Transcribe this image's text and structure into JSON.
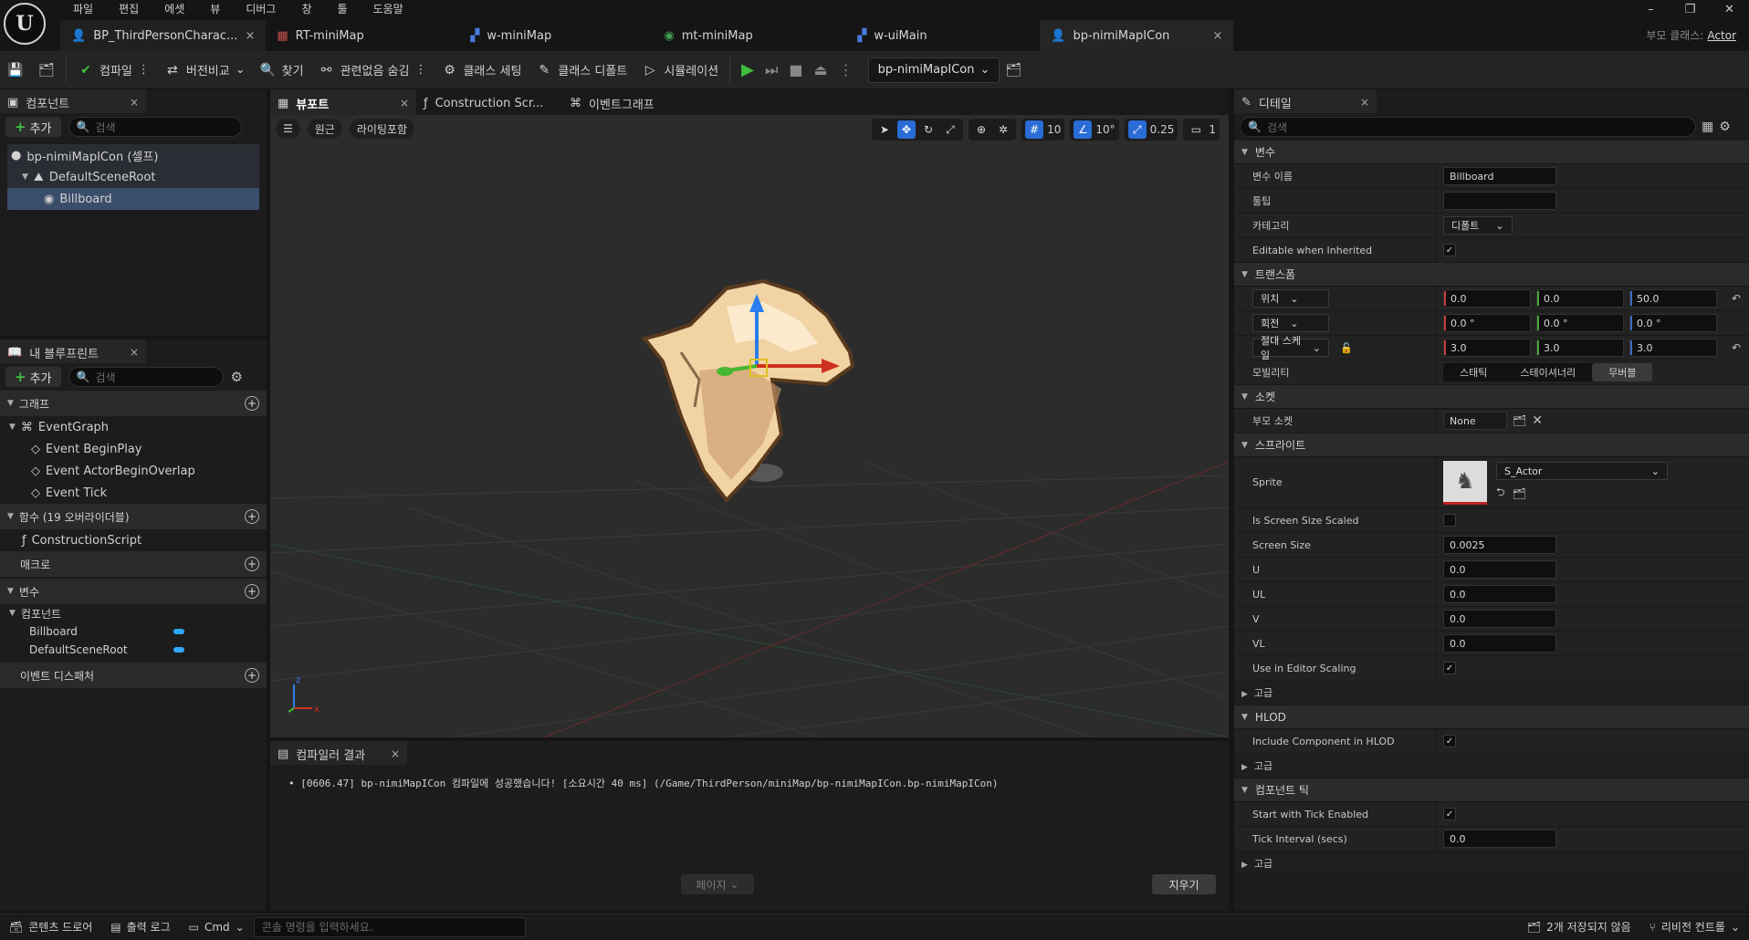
{
  "menu": [
    "파일",
    "편집",
    "에셋",
    "뷰",
    "디버그",
    "창",
    "툴",
    "도움말"
  ],
  "doc_tabs": [
    {
      "label": "BP_ThirdPersonCharac...",
      "close": "×"
    },
    {
      "label": "RT-miniMap"
    },
    {
      "label": "w-miniMap"
    },
    {
      "label": "mt-miniMap"
    },
    {
      "label": "w-uiMain"
    },
    {
      "label": "bp-nimiMapICon",
      "close": "×"
    }
  ],
  "window_buttons": [
    "–",
    "❐",
    "✕"
  ],
  "parent_class": {
    "label": "부모 클래스:",
    "value": "Actor"
  },
  "toolbar": {
    "compile": "컴파일",
    "diff": "버전비교",
    "find": "찾기",
    "hide_unrelated": "관련없음 숨김",
    "class_settings": "클래스 세팅",
    "class_defaults": "클래스 디폴트",
    "simulation": "시뮬레이션",
    "debug_object": "bp-nimiMapICon"
  },
  "components_panel": {
    "tab": "컴포넌트",
    "add": "추가",
    "search_placeholder": "검색",
    "items": [
      {
        "label": "bp-nimiMapICon (셀프)"
      },
      {
        "label": "DefaultSceneRoot"
      },
      {
        "label": "Billboard"
      }
    ]
  },
  "my_blueprint": {
    "tab": "내 블루프린트",
    "add": "추가",
    "search_placeholder": "검색",
    "graph_header": "그래프",
    "event_graph": "EventGraph",
    "events": [
      "Event BeginPlay",
      "Event ActorBeginOverlap",
      "Event Tick"
    ],
    "functions_header": "함수 (19 오버라이더블)",
    "construction_script": "ConstructionScript",
    "macros_header": "매크로",
    "variables_header": "변수",
    "components_header": "컴포넌트",
    "variables": [
      "Billboard",
      "DefaultSceneRoot"
    ],
    "dispatchers_header": "이벤트 디스패처"
  },
  "center_tabs": [
    "뷰포트",
    "Construction Scr...",
    "이벤트그래프"
  ],
  "viewport": {
    "perspective": "원근",
    "lit": "라이팅포함",
    "grid_snap": "10",
    "rot_snap": "10°",
    "scale_snap": "0.25",
    "camera_speed": "1"
  },
  "compiler": {
    "tab": "컴파일러 결과",
    "message": "[0606.47] bp-nimiMapICon 컴파일에 성공했습니다! [소요시간 40 ms] (/Game/ThirdPerson/miniMap/bp-nimiMapICon.bp-nimiMapICon)",
    "page": "페이지",
    "clear": "지우기"
  },
  "details": {
    "tab": "디테일",
    "search_placeholder": "검색",
    "sec_variable": "변수",
    "var_name_label": "변수 이름",
    "var_name": "Billboard",
    "tooltip_label": "툴팁",
    "category_label": "카테고리",
    "category": "디폴트",
    "editable_label": "Editable when Inherited",
    "sec_transform": "트랜스폼",
    "location_label": "위치",
    "location": [
      "0.0",
      "0.0",
      "50.0"
    ],
    "rotation_label": "회전",
    "rotation": [
      "0.0 °",
      "0.0 °",
      "0.0 °"
    ],
    "scale_label": "절대 스케일",
    "scale": [
      "3.0",
      "3.0",
      "3.0"
    ],
    "mobility_label": "모빌리티",
    "mobility": [
      "스태틱",
      "스테이셔너리",
      "무버블"
    ],
    "sec_socket": "소켓",
    "parent_socket_label": "부모 소켓",
    "parent_socket": "None",
    "sec_sprite": "스프라이트",
    "sprite_label": "Sprite",
    "sprite_value": "S_Actor",
    "screen_size_scaled_label": "Is Screen Size Scaled",
    "screen_size_label": "Screen Size",
    "screen_size": "0.0025",
    "u_label": "U",
    "u": "0.0",
    "ul_label": "UL",
    "ul": "0.0",
    "v_label": "V",
    "v": "0.0",
    "vl_label": "VL",
    "vl": "0.0",
    "editor_scaling_label": "Use in Editor Scaling",
    "advanced": "고급",
    "sec_hlod": "HLOD",
    "include_hlod_label": "Include Component in HLOD",
    "sec_tick": "컴포넌트 틱",
    "tick_enabled_label": "Start with Tick Enabled",
    "tick_interval_label": "Tick Interval (secs)",
    "tick_interval": "0.0"
  },
  "statusbar": {
    "content_drawer": "콘텐츠 드로어",
    "output_log": "출력 로그",
    "cmd": "Cmd",
    "cmd_placeholder": "콘솔 명령을 입력하세요.",
    "unsaved": "2개 저장되지 않음",
    "revision": "리비전 컨트롤"
  }
}
